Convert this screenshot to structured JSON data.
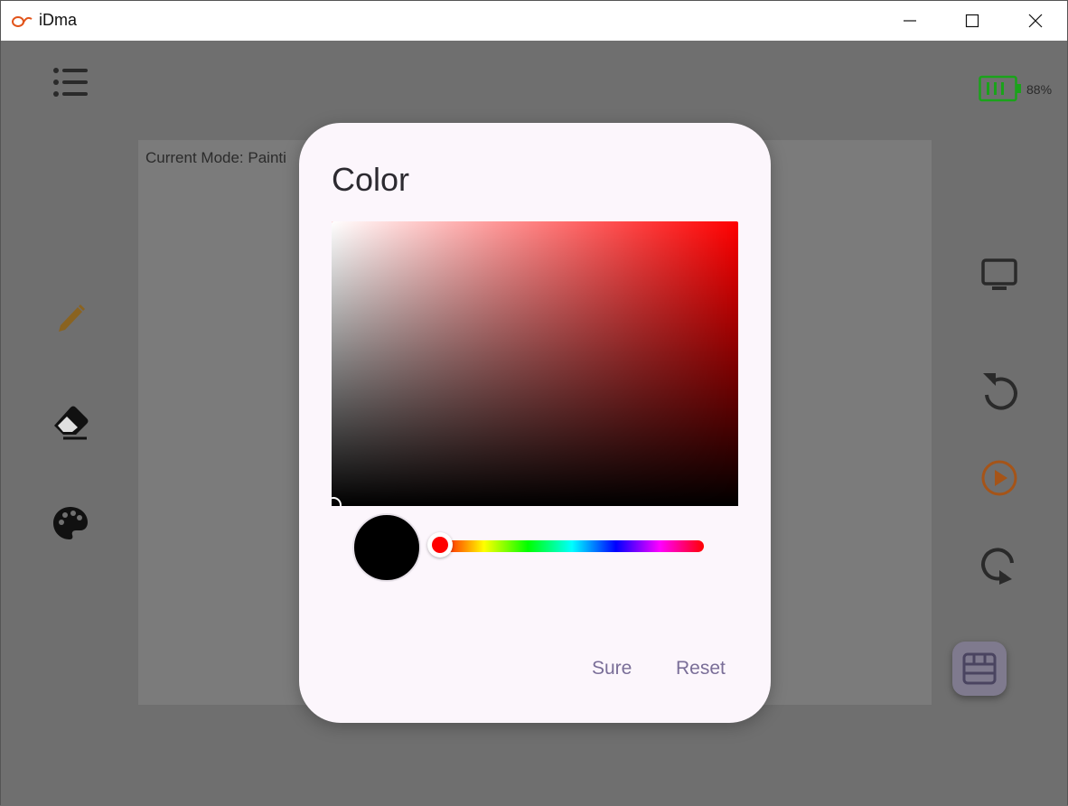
{
  "window": {
    "title": "iDma",
    "controls": [
      "minimize",
      "maximize",
      "close"
    ]
  },
  "toolbar_left": {
    "icons": [
      "menu-icon",
      "pencil-icon",
      "eraser-icon",
      "palette-icon"
    ],
    "colors": {
      "pencil": "#8a6320",
      "default": "#111111"
    }
  },
  "toolbar_right": {
    "icons": [
      "monitor-icon",
      "rotate-left-icon",
      "play-icon",
      "rotate-right-icon",
      "keyboard-icon"
    ],
    "colors": {
      "play": "#a55418",
      "default": "#2a2a2a"
    }
  },
  "battery": {
    "level": "88%",
    "color": "#1aa31a"
  },
  "canvas": {
    "mode_text": "Current Mode: Painti"
  },
  "color_dialog": {
    "title": "Color",
    "selected_color": "#000000",
    "hue_color": "#ff0000",
    "hue": 0,
    "saturation": 0,
    "value": 0,
    "buttons": {
      "sure": "Sure",
      "reset": "Reset"
    }
  },
  "colors": {
    "dialog_bg": "#fcf6fc",
    "button_text": "#7a6e98",
    "overlay": "#6f6f6f"
  }
}
